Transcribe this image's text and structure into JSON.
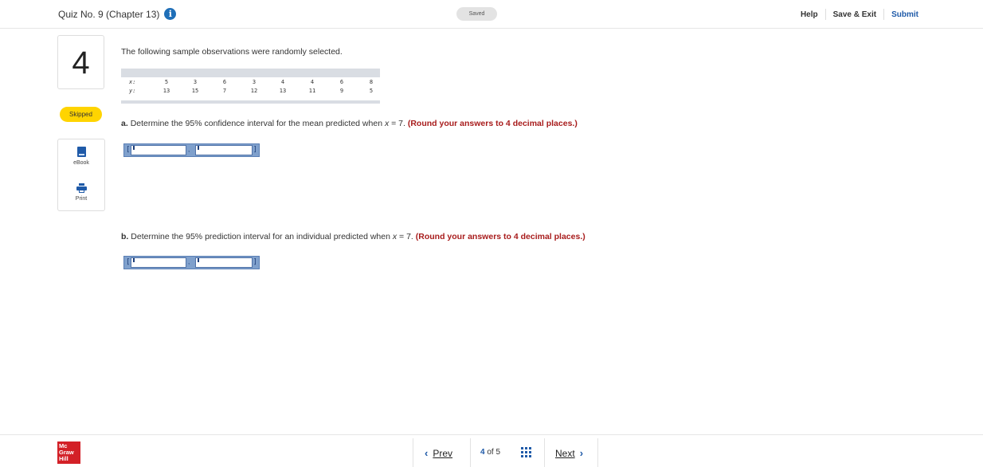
{
  "header": {
    "quiz_title": "Quiz No. 9 (Chapter 13)",
    "info_glyph": "i",
    "saved_label": "Saved",
    "help_label": "Help",
    "save_exit_label": "Save & Exit",
    "submit_label": "Submit"
  },
  "sidebar": {
    "question_number": "4",
    "status_badge": "Skipped",
    "tools": [
      {
        "label": "eBook",
        "icon": "book-icon"
      },
      {
        "label": "Print",
        "icon": "printer-icon"
      }
    ]
  },
  "question": {
    "intro": "The following sample observations were randomly selected.",
    "table": {
      "x_label": "x:",
      "y_label": "y:",
      "x_values": [
        "5",
        "3",
        "6",
        "3",
        "4",
        "4",
        "6",
        "8"
      ],
      "y_values": [
        "13",
        "15",
        "7",
        "12",
        "13",
        "11",
        "9",
        "5"
      ]
    },
    "part_a": {
      "letter": "a.",
      "text_before": "Determine the 95% confidence interval for the mean predicted when ",
      "var": "x",
      "text_after": " = 7. ",
      "round_note": "(Round your answers to 4 decimal places.)",
      "lower_value": "",
      "upper_value": ""
    },
    "part_b": {
      "letter": "b.",
      "text_before": "Determine the 95% prediction interval for an individual predicted when ",
      "var": "x",
      "text_after": " = 7. ",
      "round_note": "(Round your answers to 4 decimal places.)",
      "lower_value": "",
      "upper_value": ""
    },
    "interval_brackets": {
      "open": "[",
      "close": "]",
      "comma": ","
    }
  },
  "footer": {
    "logo_lines": [
      "Mc",
      "Graw",
      "Hill"
    ],
    "prev_label": "Prev",
    "next_label": "Next",
    "current_page": "4",
    "of_label": "of",
    "total_pages": "5",
    "prev_glyph": "‹",
    "next_glyph": "›"
  },
  "colors": {
    "accent": "#1f5aa8",
    "round_note": "#a81c1c",
    "skipped_badge": "#ffd400",
    "logo": "#d32027"
  }
}
